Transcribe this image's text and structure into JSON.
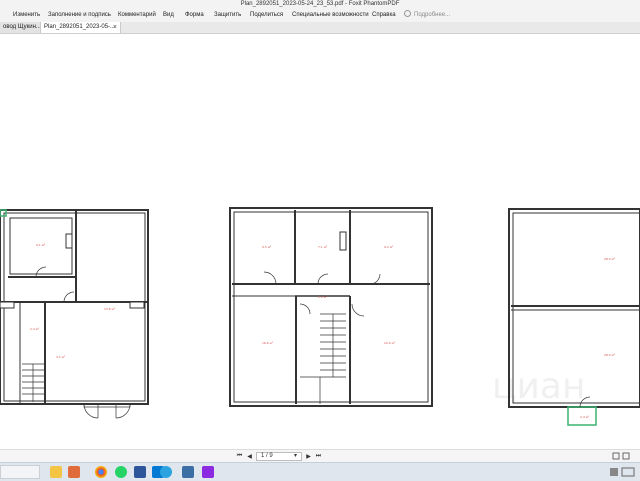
{
  "window": {
    "title": "Plan_2892051_2023-05-24_23_53.pdf - Foxit PhantomPDF"
  },
  "menu": {
    "items": [
      "Изменить",
      "Заполнение и подпись",
      "Комментарий",
      "Вид",
      "Форма",
      "Защитить",
      "Поделиться",
      "Специальные возможности",
      "Справка"
    ],
    "search_hint": "Подробнее..."
  },
  "tabs": [
    {
      "label": "овод Щукин..."
    },
    {
      "label": "Plan_2892051_2023-05-...",
      "close": "×"
    }
  ],
  "plan": {
    "watermark": "циан"
  },
  "nav": {
    "first": "⏮",
    "prev": "◀",
    "page_label": "1 / 9",
    "dropdown": "▾",
    "next": "▶",
    "last": "⏭"
  },
  "colors": {
    "accent_green": "#3cb371",
    "red_label": "#d9534f",
    "line": "#333333"
  },
  "taskbar_icons": [
    "file-explorer-icon",
    "office-icon",
    "chrome-icon",
    "whatsapp-icon",
    "word-icon",
    "outlook-icon",
    "telegram-icon",
    "calendar-icon",
    "foxit-icon"
  ]
}
